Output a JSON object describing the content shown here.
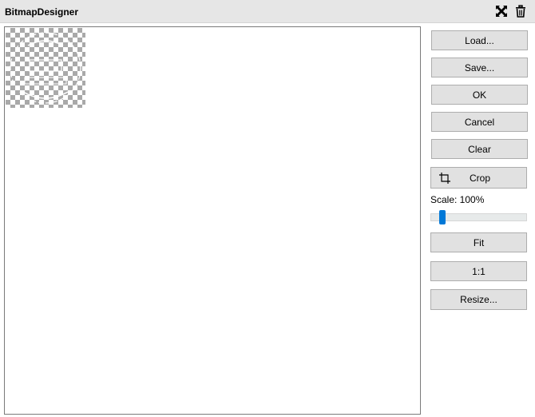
{
  "window": {
    "title": "BitmapDesigner"
  },
  "titlebar_icons": [
    "maximize-icon",
    "trash-icon"
  ],
  "buttons": {
    "load": "Load...",
    "save": "Save...",
    "ok": "OK",
    "cancel": "Cancel",
    "clear": "Clear",
    "crop": "Crop",
    "fit": "Fit",
    "one_to_one": "1:1",
    "resize": "Resize..."
  },
  "scale": {
    "label": "Scale: 100%",
    "value_percent": 100,
    "slider_fraction": 0.1
  },
  "colors": {
    "accent": "#0078d7",
    "button_bg": "#e1e1e1",
    "checker": "#a9a9a9"
  }
}
